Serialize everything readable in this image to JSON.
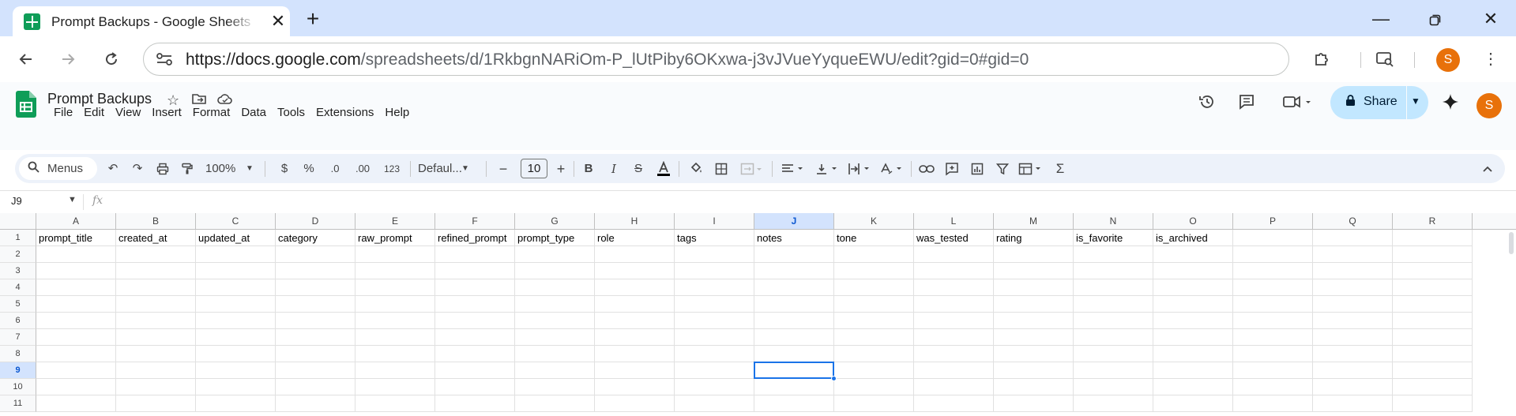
{
  "browser": {
    "tab_title": "Prompt Backups - Google Sheets",
    "url_host": "https://docs.google.com",
    "url_path": "/spreadsheets/d/1RkbgnNARiOm-P_lUtPiby6OKxwa-j3vJVueYyqueEWU/edit?gid=0#gid=0",
    "profile_initial": "S"
  },
  "doc": {
    "title": "Prompt Backups",
    "menu": [
      "File",
      "Edit",
      "View",
      "Insert",
      "Format",
      "Data",
      "Tools",
      "Extensions",
      "Help"
    ],
    "share_label": "Share",
    "user_initial": "S"
  },
  "toolbar": {
    "menus_label": "Menus",
    "zoom": "100%",
    "currency": "$",
    "percent": "%",
    "dec_decrease": ".0",
    "dec_increase": ".00",
    "number_format": "123",
    "font": "Defaul...",
    "font_size": "10"
  },
  "formula_bar": {
    "name_box": "J9",
    "fx": "fx",
    "value": ""
  },
  "sheet": {
    "columns": [
      "A",
      "B",
      "C",
      "D",
      "E",
      "F",
      "G",
      "H",
      "I",
      "J",
      "K",
      "L",
      "M",
      "N",
      "O",
      "P",
      "Q",
      "R"
    ],
    "rows": [
      "1",
      "2",
      "3",
      "4",
      "5",
      "6",
      "7",
      "8",
      "9",
      "10",
      "11"
    ],
    "header_row": [
      "prompt_title",
      "created_at",
      "updated_at",
      "category",
      "raw_prompt",
      "refined_prompt",
      "prompt_type",
      "role",
      "tags",
      "notes",
      "tone",
      "was_tested",
      "rating",
      "is_favorite",
      "is_archived",
      "",
      "",
      ""
    ],
    "active_cell": "J9",
    "accent": "#1a73e8"
  }
}
